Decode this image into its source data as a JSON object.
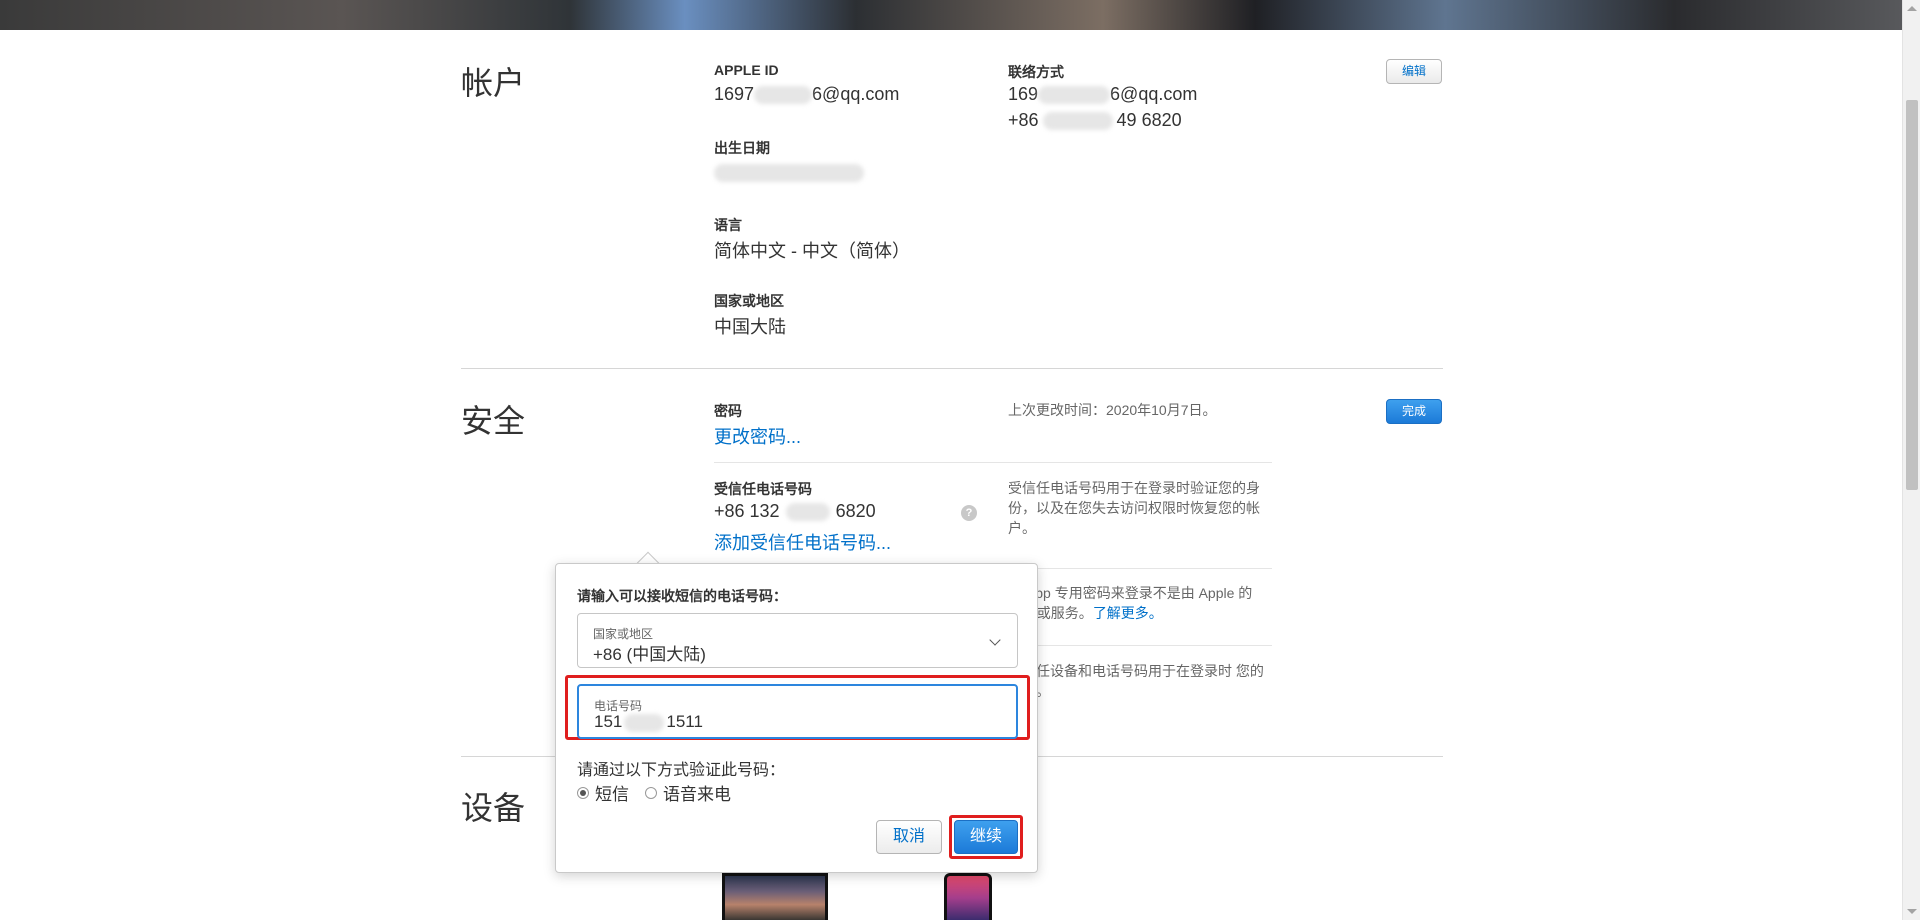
{
  "account": {
    "title": "帐户",
    "apple_id_label": "APPLE ID",
    "apple_id_prefix": "1697",
    "apple_id_suffix": "6@qq.com",
    "contact_label": "联络方式",
    "contact_email_prefix": "169",
    "contact_email_suffix": "6@qq.com",
    "contact_phone_prefix": "+86",
    "contact_phone_suffix": "49 6820",
    "birthday_label": "出生日期",
    "language_label": "语言",
    "language_value": "简体中文 - 中文（简体）",
    "region_label": "国家或地区",
    "region_value": "中国大陆",
    "edit_button": "编辑"
  },
  "security": {
    "title": "安全",
    "password_label": "密码",
    "change_password_link": "更改密码...",
    "last_changed": "上次更改时间：2020年10月7日。",
    "done_button": "完成",
    "trusted_phone_label": "受信任电话号码",
    "trusted_phone_prefix": "+86 132",
    "trusted_phone_suffix": "6820",
    "help_icon_glyph": "?",
    "add_trusted_phone_link": "添加受信任电话号码...",
    "trusted_phone_desc": "受信任电话号码用于在登录时验证您的身份，以及在您失去访问权限时恢复您的帐户。",
    "app_password_desc": "用 App 专用密码来登录不是由 Apple 的 App 或服务。",
    "learn_more_link": "了解更多。",
    "two_factor_desc": "受信任设备和电话号码用于在登录时 您的身份。"
  },
  "devices": {
    "title": "设备"
  },
  "popup": {
    "title": "请输入可以接收短信的电话号码：",
    "country_label": "国家或地区",
    "country_value": "+86 (中国大陆)",
    "phone_label": "电话号码",
    "phone_prefix": "151",
    "phone_suffix": "1511",
    "verify_label": "请通过以下方式验证此号码：",
    "option_sms": "短信",
    "option_voice": "语音来电",
    "cancel_button": "取消",
    "continue_button": "继续"
  },
  "colors": {
    "link": "#0070c9",
    "primary_button": "#1c7ad8",
    "highlight": "#e01e1e"
  }
}
